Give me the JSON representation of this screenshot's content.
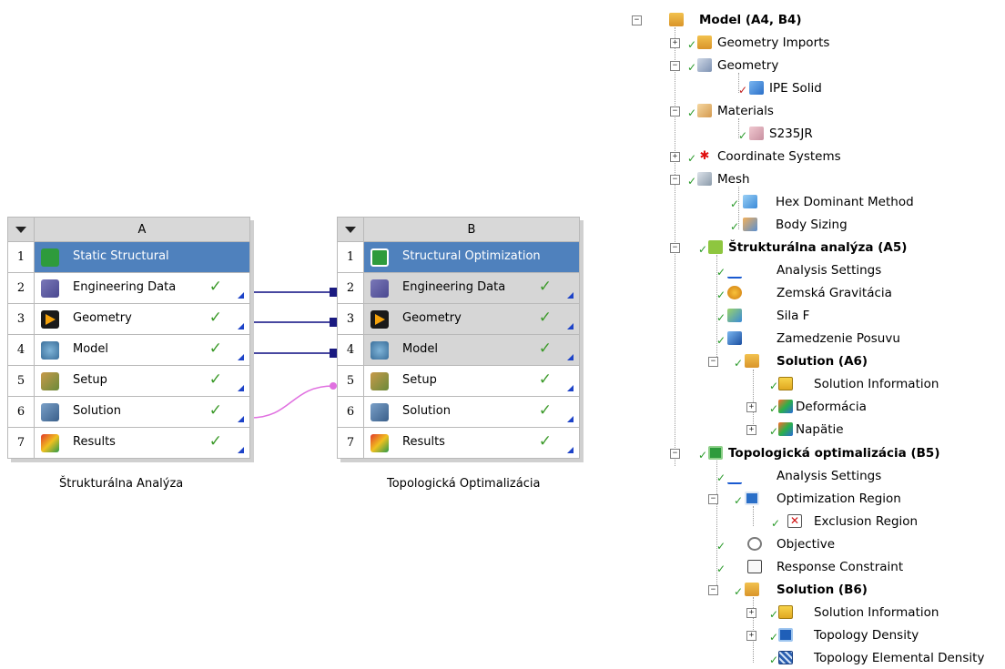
{
  "systems": [
    {
      "column": "A",
      "caption": "Štrukturálna Analýza",
      "rows": [
        {
          "num": "1",
          "label": "Static Structural",
          "icon": "static-structural-icon"
        },
        {
          "num": "2",
          "label": "Engineering Data",
          "icon": "engineering-data-icon",
          "status": "✓"
        },
        {
          "num": "3",
          "label": "Geometry",
          "icon": "geometry-icon",
          "status": "✓"
        },
        {
          "num": "4",
          "label": "Model",
          "icon": "model-icon",
          "status": "✓"
        },
        {
          "num": "5",
          "label": "Setup",
          "icon": "setup-icon",
          "status": "✓"
        },
        {
          "num": "6",
          "label": "Solution",
          "icon": "solution-icon",
          "status": "✓"
        },
        {
          "num": "7",
          "label": "Results",
          "icon": "results-icon",
          "status": "✓"
        }
      ]
    },
    {
      "column": "B",
      "caption": "Topologická Optimalizácia",
      "rows": [
        {
          "num": "1",
          "label": "Structural Optimization",
          "icon": "structural-optimization-icon"
        },
        {
          "num": "2",
          "label": "Engineering Data",
          "icon": "engineering-data-icon",
          "status": "✓"
        },
        {
          "num": "3",
          "label": "Geometry",
          "icon": "geometry-icon",
          "status": "✓"
        },
        {
          "num": "4",
          "label": "Model",
          "icon": "model-icon",
          "status": "✓"
        },
        {
          "num": "5",
          "label": "Setup",
          "icon": "setup-icon",
          "status": "✓"
        },
        {
          "num": "6",
          "label": "Solution",
          "icon": "solution-icon",
          "status": "✓"
        },
        {
          "num": "7",
          "label": "Results",
          "icon": "results-icon",
          "status": "✓"
        }
      ]
    }
  ],
  "colors": {
    "title_row": "#4f81bd",
    "link_line": "#4848a0",
    "setup_link": "#e070e0",
    "status_check": "#3c9a2a",
    "status_triangle": "#1d43c8"
  },
  "tree": {
    "model": "Model (A4, B4)",
    "geometry_imports": "Geometry Imports",
    "geometry": "Geometry",
    "ipe_solid": "IPE Solid",
    "materials": "Materials",
    "s235jr": "S235JR",
    "coordinate_systems": "Coordinate Systems",
    "mesh": "Mesh",
    "hex_dominant": "Hex Dominant Method",
    "body_sizing": "Body Sizing",
    "structural_analysis": "Štrukturálna analýza (A5)",
    "analysis_settings_a": "Analysis Settings",
    "gravity": "Zemská Gravitácia",
    "force": "Sila F",
    "support": "Zamedzenie Posuvu",
    "solution_a6": "Solution (A6)",
    "solution_information_a": "Solution Information",
    "deformation": "Deformácia",
    "stress": "Napätie",
    "topology_opt": "Topologická optimalizácia (B5)",
    "analysis_settings_b": "Analysis Settings",
    "optimization_region": "Optimization Region",
    "exclusion_region": "Exclusion Region",
    "objective": "Objective",
    "response_constraint": "Response Constraint",
    "solution_b6": "Solution (B6)",
    "solution_information_b": "Solution Information",
    "topology_density": "Topology Density",
    "topology_elemental_density": "Topology Elemental Density",
    "expand_glyph": "+",
    "collapse_glyph": "−",
    "check_glyph": "✓"
  }
}
